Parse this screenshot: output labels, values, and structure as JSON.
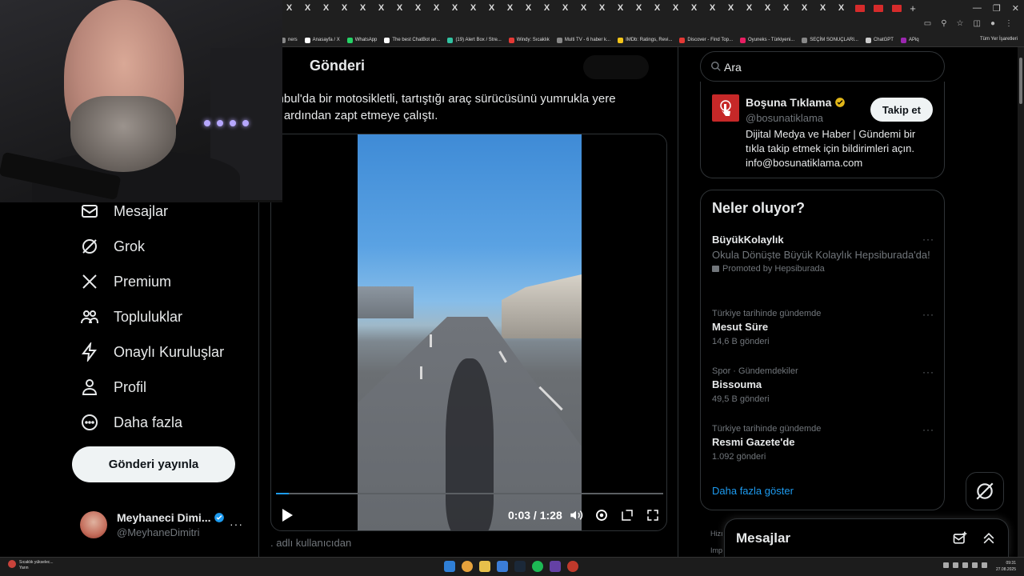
{
  "browser": {
    "tab_glyph": "X",
    "tab_count": 34,
    "bookmarks": [
      {
        "label": "ners",
        "color": "#888888"
      },
      {
        "label": "Anasayfa / X",
        "color": "#ffffff"
      },
      {
        "label": "WhatsApp",
        "color": "#25d366"
      },
      {
        "label": "The best ChatBot an...",
        "color": "#ffffff"
      },
      {
        "label": "(19) Alert Box / Stre...",
        "color": "#31c3a2"
      },
      {
        "label": "Windy: Sıcaklık",
        "color": "#e53935"
      },
      {
        "label": "Multi TV - 6 haber k...",
        "color": "#888888"
      },
      {
        "label": "IMDb: Ratings, Revi...",
        "color": "#f5c518"
      },
      {
        "label": "Discover - Find Top...",
        "color": "#e53935"
      },
      {
        "label": "Oyuneks - Türkiyeni...",
        "color": "#e91e63"
      },
      {
        "label": "SEÇİM SONUÇLARI...",
        "color": "#888888"
      },
      {
        "label": "ChatGPT",
        "color": "#cccccc"
      },
      {
        "label": "APiq",
        "color": "#9c27b0"
      }
    ],
    "bookmarks_right": "Tüm Yer İşaretleri"
  },
  "nav": {
    "items": [
      {
        "label": "Mesajlar",
        "icon": "mail-icon"
      },
      {
        "label": "Grok",
        "icon": "grok-icon"
      },
      {
        "label": "Premium",
        "icon": "x-logo-icon"
      },
      {
        "label": "Topluluklar",
        "icon": "people-icon"
      },
      {
        "label": "Onaylı Kuruluşlar",
        "icon": "lightning-icon"
      },
      {
        "label": "Profil",
        "icon": "person-icon"
      },
      {
        "label": "Daha fazla",
        "icon": "more-circle-icon"
      }
    ],
    "post_button": "Gönderi yayınla",
    "account": {
      "name": "Meyhaneci Dimi...",
      "handle": "@MeyhaneDimitri",
      "more": "···"
    }
  },
  "main": {
    "title": "Gönderi",
    "post_text": "tanbul'da bir motosikletli, tartıştığı araç sürücüsünü yumrukla yere\nrip ardından zapt etmeye çalıştı.",
    "video": {
      "current": "0:03",
      "separator": "/",
      "duration": "1:28",
      "progress_fraction": 0.034
    },
    "attribution": ". adlı kullanıcıdan"
  },
  "right": {
    "search_placeholder": "Ara",
    "suggested": {
      "name": "Boşuna Tıklama",
      "handle": "@bosunatiklama",
      "follow_label": "Takip et",
      "bio": "Dijital Medya ve Haber | Gündemi bir tıkla takip etmek için bildirimleri açın. info@bosunatiklama.com"
    },
    "trends_title": "Neler oluyor?",
    "promoted": {
      "name": "BüyükKolaylık",
      "desc": "Okula Dönüşte Büyük Kolaylık Hepsiburada'da!",
      "by": "Promoted by Hepsiburada"
    },
    "trends": [
      {
        "context": "Türkiye tarihinde gündemde",
        "name": "Mesut Süre",
        "count": "14,6 B gönderi"
      },
      {
        "context": "Spor · Gündemdekiler",
        "name": "Bissouma",
        "count": "49,5 B gönderi"
      },
      {
        "context": "Türkiye tarihinde gündemde",
        "name": "Resmi Gazete'de",
        "count": "1.092 gönderi"
      }
    ],
    "more_glyph": "···",
    "show_more": "Daha fazla göster",
    "footer_a": "Hizı",
    "footer_b": "Imp",
    "messages_title": "Mesajlar"
  },
  "taskbar": {
    "weather_line1": "Sıcaklık yükselec...",
    "weather_line2": "Yarın",
    "time": "09:31",
    "date": "27.08.2025"
  },
  "colors": {
    "accent": "#1d9bf0",
    "verified": "#1d9bf0",
    "gold_badge": "#e2b719",
    "background": "#000000"
  }
}
